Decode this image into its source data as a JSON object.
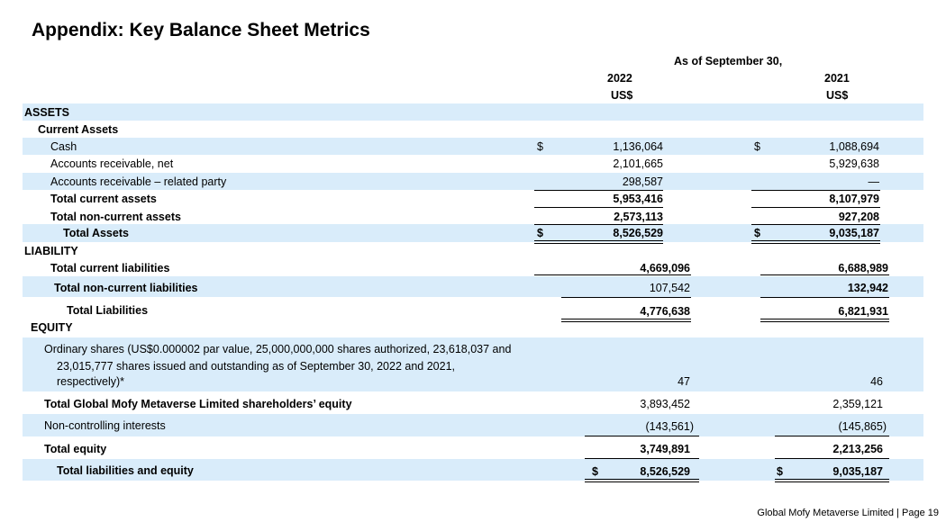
{
  "title": "Appendix: Key Balance Sheet Metrics",
  "header": {
    "period": "As of September 30,",
    "year1": "2022",
    "year2": "2021",
    "currency1": "US$",
    "currency2": "US$"
  },
  "rows": {
    "assets": "ASSETS",
    "current_assets": "Current Assets",
    "cash": {
      "label": "Cash",
      "cur1": "$",
      "v1": "1,136,064",
      "cur2": "$",
      "v2": "1,088,694"
    },
    "ar": {
      "label": "Accounts receivable, net",
      "v1": "2,101,665",
      "v2": "5,929,638"
    },
    "ar_related": {
      "label": "Accounts receivable – related party",
      "v1": "298,587",
      "v2": "—"
    },
    "tca": {
      "label": "Total current assets",
      "v1": "5,953,416",
      "v2": "8,107,979"
    },
    "tnca": {
      "label": "Total non-current assets",
      "v1": "2,573,113",
      "v2": "927,208"
    },
    "ta": {
      "label": "Total Assets",
      "cur1": "$",
      "v1": "8,526,529",
      "cur2": "$",
      "v2": "9,035,187"
    },
    "liability": "LIABILITY",
    "tcl": {
      "label": "Total current liabilities",
      "v1": "4,669,096",
      "v2": "6,688,989"
    },
    "tncl": {
      "label": "Total non-current liabilities",
      "v1": "107,542",
      "v2": "132,942"
    },
    "tl": {
      "label": "Total Liabilities",
      "v1": "4,776,638",
      "v2": "6,821,931"
    },
    "equity": "EQUITY",
    "ord": {
      "line1": "Ordinary shares (US$0.000002 par value, 25,000,000,000 shares authorized, 23,618,037 and",
      "line2": "23,015,777 shares issued and outstanding as of September 30, 2022 and 2021,",
      "line3": "respectively)*",
      "v1": "47",
      "v2": "46"
    },
    "tgse": {
      "label": "Total Global Mofy Metaverse Limited shareholders’ equity",
      "v1": "3,893,452",
      "v2": "2,359,121"
    },
    "nci": {
      "label": "Non-controlling interests",
      "v1": "(143,561)",
      "v2": "(145,865)"
    },
    "te": {
      "label": "Total equity",
      "v1": "3,749,891",
      "v2": "2,213,256"
    },
    "tle": {
      "label": "Total liabilities and equity",
      "cur1": "$",
      "v1": "8,526,529",
      "cur2": "$",
      "v2": "9,035,187"
    }
  },
  "footer": "Global Mofy Metaverse Limited | Page 19"
}
